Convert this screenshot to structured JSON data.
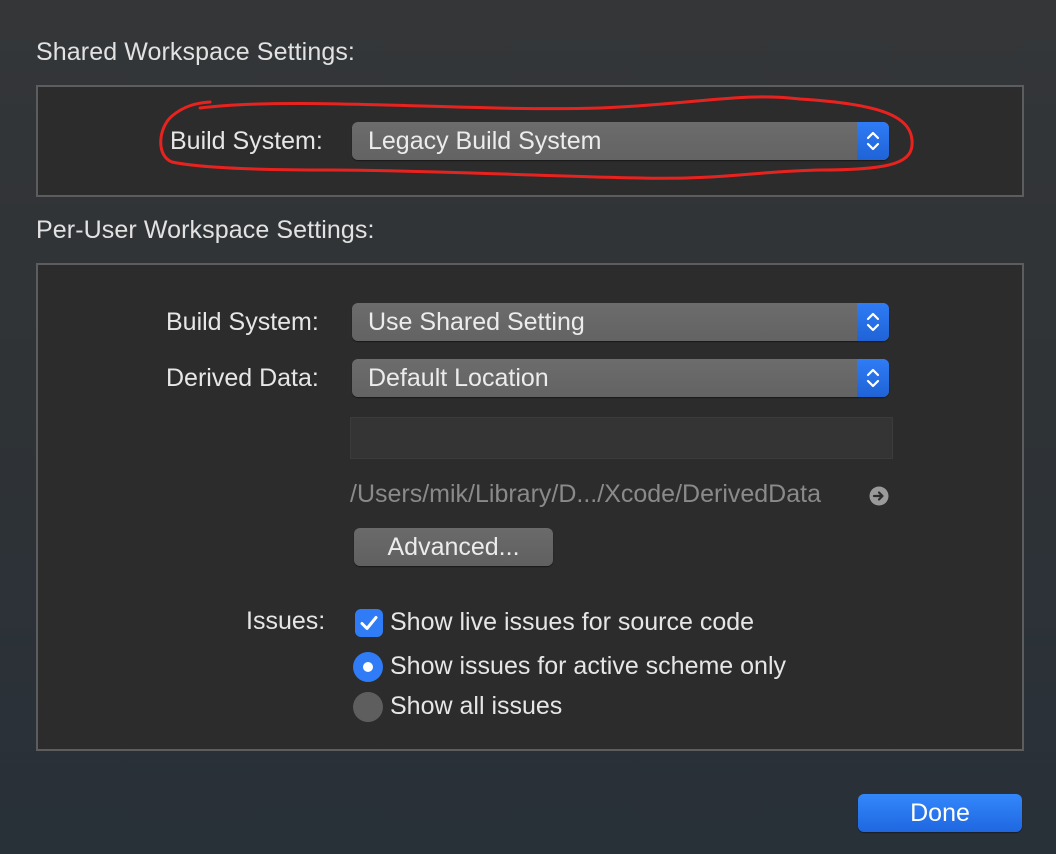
{
  "shared": {
    "title": "Shared Workspace Settings:",
    "build_system_label": "Build System:",
    "build_system_value": "Legacy Build System"
  },
  "per_user": {
    "title": "Per-User Workspace Settings:",
    "build_system_label": "Build System:",
    "build_system_value": "Use Shared Setting",
    "derived_data_label": "Derived Data:",
    "derived_data_value": "Default Location",
    "derived_data_path": "/Users/mik/Library/D.../Xcode/DerivedData",
    "advanced_label": "Advanced...",
    "issues_label": "Issues:",
    "options": {
      "live_issues": "Show live issues for source code",
      "active_scheme": "Show issues for active scheme only",
      "all_issues": "Show all issues"
    },
    "live_issues_checked": true,
    "selected_radio": "active_scheme"
  },
  "footer": {
    "done_label": "Done"
  },
  "icons": {
    "popup_arrows": "chevron-up-down-icon",
    "reveal": "arrow-circle-right-icon",
    "checkmark": "checkmark-icon"
  },
  "colors": {
    "accent": "#2f7cf6",
    "annotation": "#e8231f",
    "background": "#2c2c2c"
  }
}
